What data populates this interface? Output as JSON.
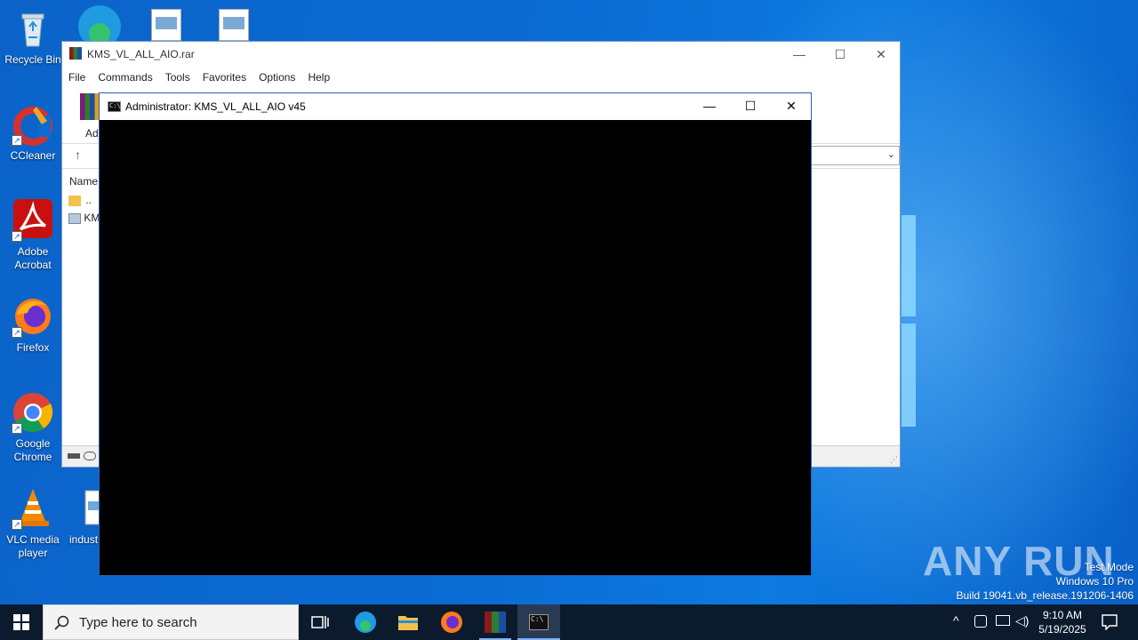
{
  "desktop": {
    "icons": [
      {
        "label": "Recycle Bin",
        "icon": "recycle-bin-icon"
      },
      {
        "label": "CCleaner",
        "icon": "ccleaner-icon"
      },
      {
        "label": "Adobe Acrobat",
        "icon": "adobe-acrobat-icon"
      },
      {
        "label": "Firefox",
        "icon": "firefox-icon"
      },
      {
        "label": "Google Chrome",
        "icon": "chrome-icon"
      },
      {
        "label": "VLC media player",
        "icon": "vlc-icon"
      },
      {
        "label": "indust",
        "icon": "file-icon"
      }
    ]
  },
  "winrar": {
    "title": "KMS_VL_ALL_AIO.rar",
    "menu": [
      "File",
      "Commands",
      "Tools",
      "Favorites",
      "Options",
      "Help"
    ],
    "toolbar_first_label": "Ad",
    "list_header_name": "Name",
    "rows": [
      "..",
      "KM"
    ]
  },
  "console": {
    "title": "Administrator:  KMS_VL_ALL_AIO v45"
  },
  "watermark": {
    "brand": "ANY RUN",
    "line1": "Test Mode",
    "line2": "Windows 10 Pro",
    "line3": "Build 19041.vb_release.191206-1406"
  },
  "taskbar": {
    "search_placeholder": "Type here to search",
    "time": "9:10 AM",
    "date": "5/19/2025"
  },
  "colors": {
    "desktop_blue": "#0a6bd3",
    "taskbar": "#0c1a2e",
    "console_bg": "#000000"
  }
}
